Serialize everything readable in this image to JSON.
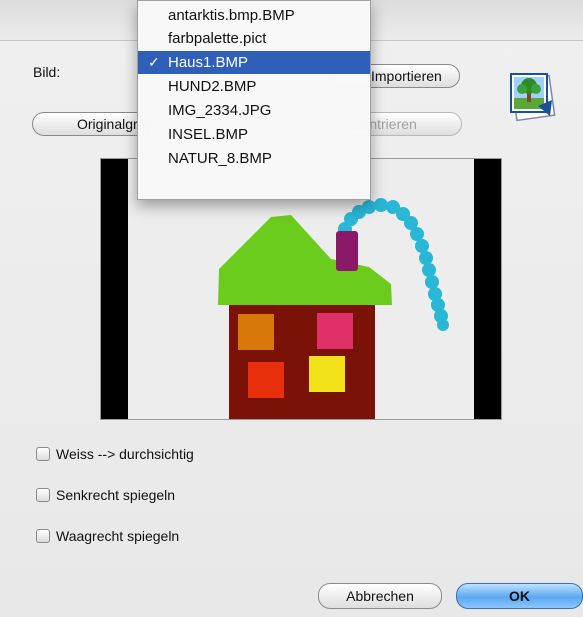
{
  "dialog": {
    "image_label": "Bild:",
    "import_button": "Importieren",
    "original_button": "Originalgrösse",
    "center_button": "Zentrieren",
    "cancel_button": "Abbrechen",
    "ok_button": "OK"
  },
  "image_menu": {
    "items": [
      {
        "label": "antarktis.bmp.BMP",
        "selected": false
      },
      {
        "label": "farbpalette.pict",
        "selected": false
      },
      {
        "label": "Haus1.BMP",
        "selected": true
      },
      {
        "label": "HUND2.BMP",
        "selected": false
      },
      {
        "label": "IMG_2334.JPG",
        "selected": false
      },
      {
        "label": "INSEL.BMP",
        "selected": false
      },
      {
        "label": "NATUR_8.BMP",
        "selected": false
      }
    ],
    "check_mark": "✓"
  },
  "options": {
    "white_transparent": {
      "label": "Weiss --> durchsichtig",
      "checked": false
    },
    "flip_vertical": {
      "label": "Senkrecht spiegeln",
      "checked": false
    },
    "flip_horizontal": {
      "label": "Waagrecht spiegeln",
      "checked": false
    }
  },
  "colors": {
    "accent_selected": "#2f5fb8",
    "ok_button": "#5aa8f0"
  }
}
